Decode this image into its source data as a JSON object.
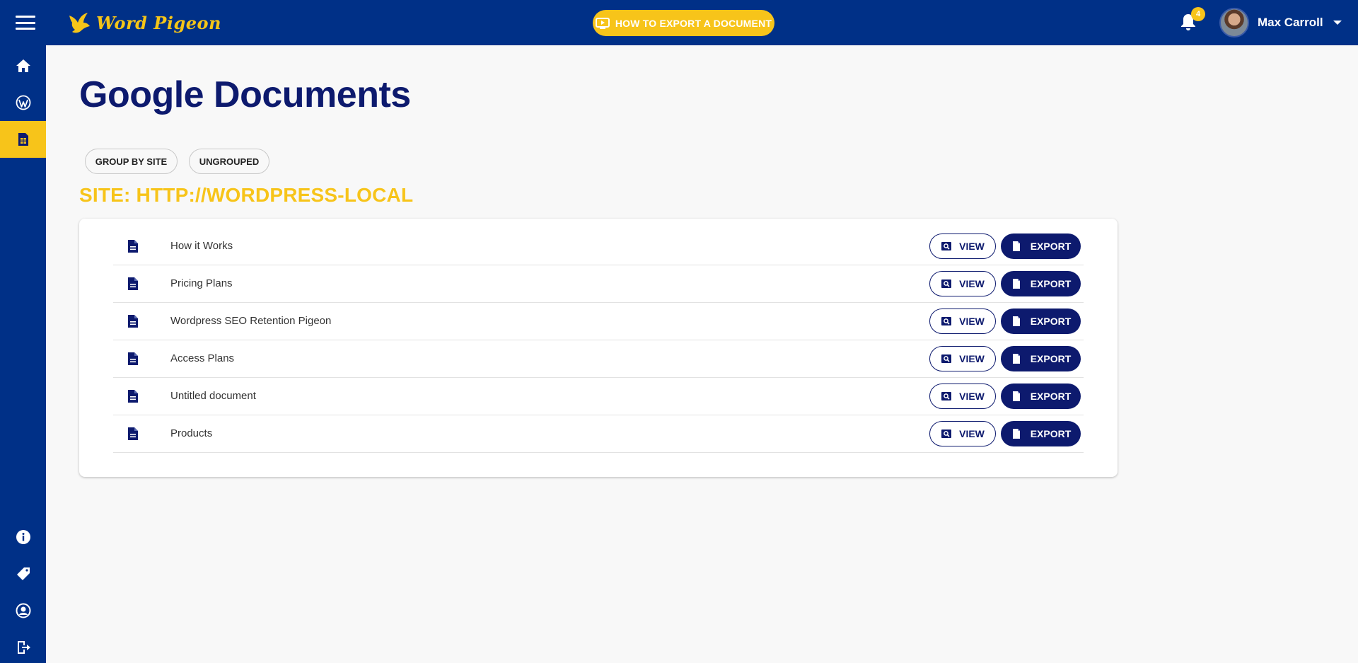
{
  "header": {
    "brand_name": "Word Pigeon",
    "howto_label": "HOW TO EXPORT A DOCUMENT",
    "notification_count": "4",
    "user_name": "Max Carroll"
  },
  "sidebar": {
    "top_items": [
      {
        "name": "home",
        "icon": "home-icon",
        "active": false
      },
      {
        "name": "wordpress",
        "icon": "wordpress-icon",
        "active": false
      },
      {
        "name": "google-docs",
        "icon": "google-docs-icon",
        "active": true
      }
    ],
    "bottom_items": [
      {
        "name": "info",
        "icon": "info-icon"
      },
      {
        "name": "pricing",
        "icon": "price-tag-icon"
      },
      {
        "name": "account",
        "icon": "user-circle-icon"
      },
      {
        "name": "logout",
        "icon": "logout-icon"
      }
    ]
  },
  "main": {
    "title": "Google Documents",
    "filters": {
      "group_by_site": "GROUP BY SITE",
      "ungrouped": "UNGROUPED"
    },
    "site_heading": "SITE: HTTP://WORDPRESS-LOCAL",
    "view_label": "VIEW",
    "export_label": "EXPORT",
    "documents": [
      {
        "name": "How it Works"
      },
      {
        "name": "Pricing Plans"
      },
      {
        "name": "Wordpress SEO Retention Pigeon"
      },
      {
        "name": "Access Plans"
      },
      {
        "name": "Untitled document"
      },
      {
        "name": "Products"
      }
    ]
  },
  "colors": {
    "navy": "#003087",
    "dark_navy": "#0d1a6e",
    "accent_yellow": "#f7c41a",
    "background": "#f8f8f8"
  }
}
